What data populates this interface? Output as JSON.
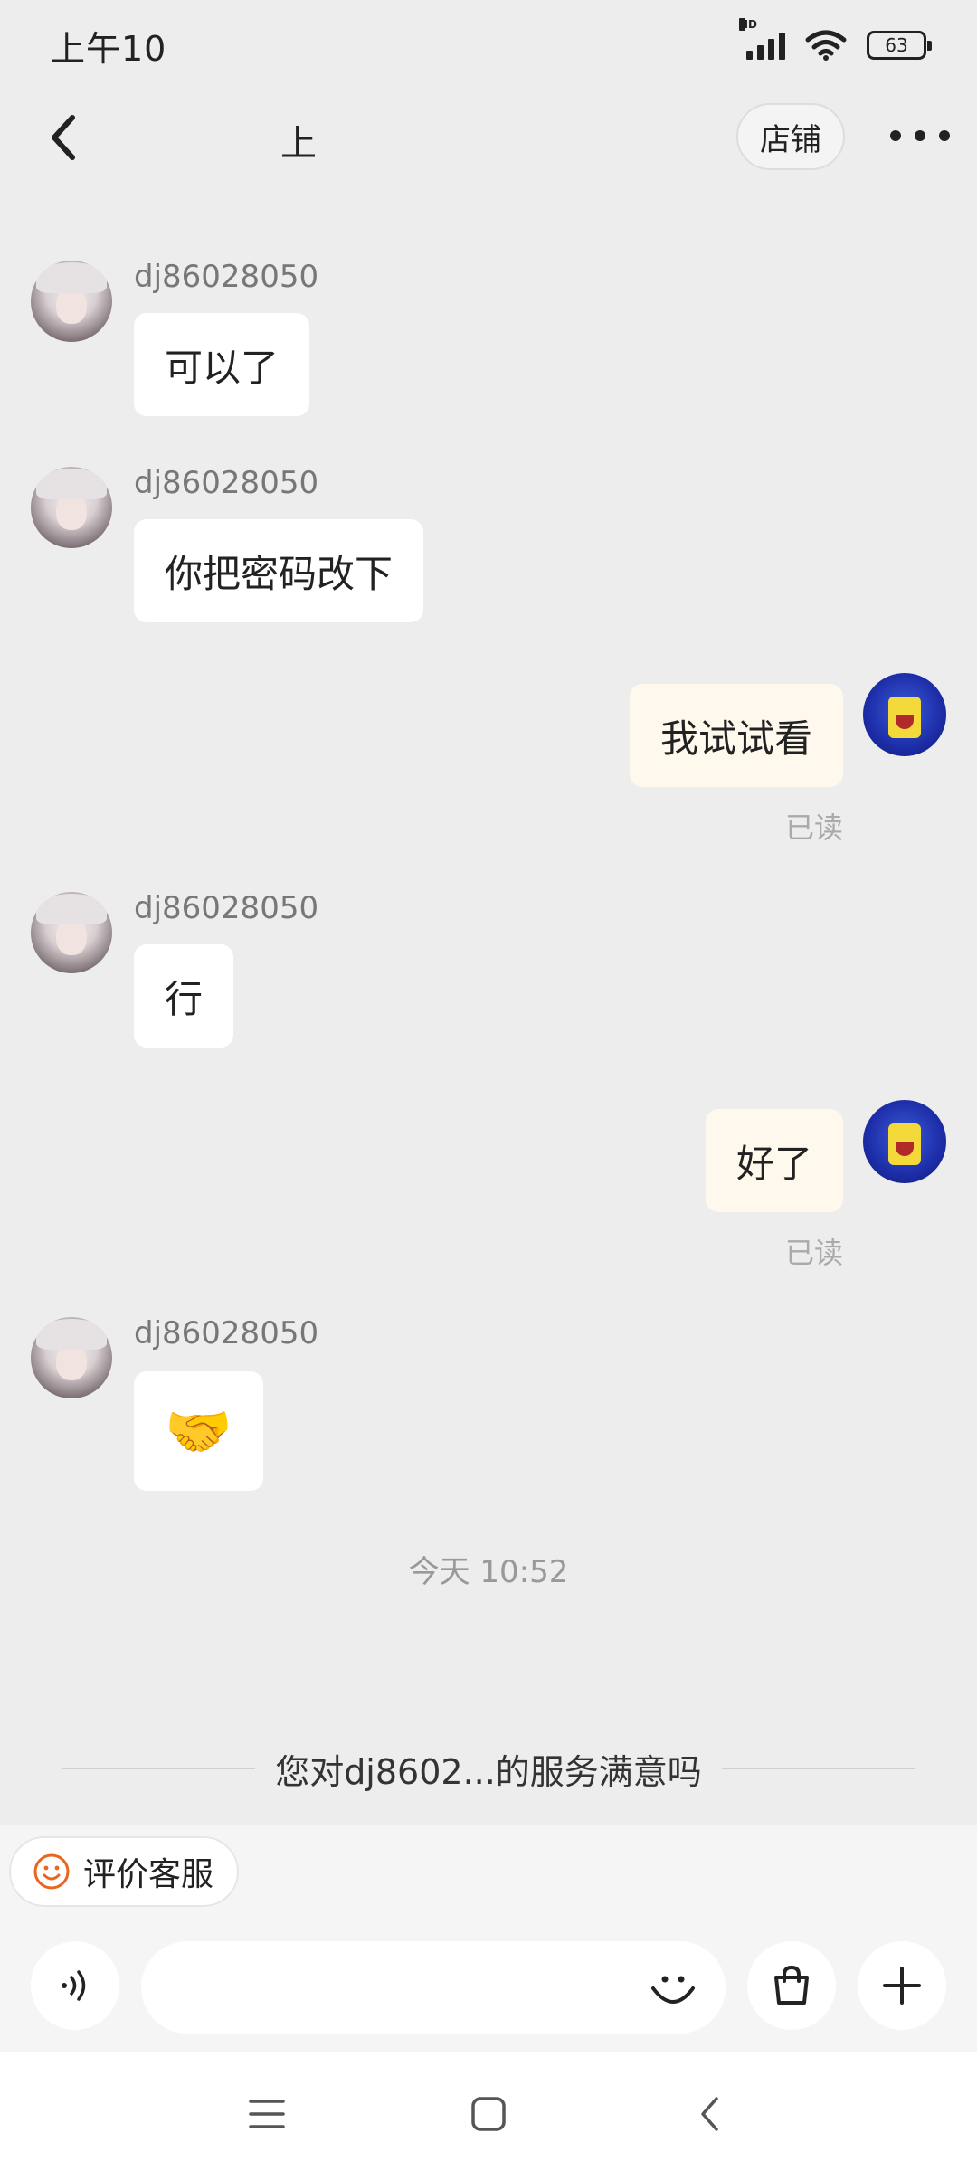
{
  "status_bar": {
    "time": "上午10",
    "battery_level": "63",
    "network_badge": "HD"
  },
  "nav": {
    "title": "上",
    "shop_label": "店铺"
  },
  "messages": [
    {
      "direction": "in",
      "sender": "dj86028050",
      "text": "可以了"
    },
    {
      "direction": "in",
      "sender": "dj86028050",
      "text": "你把密码改下"
    },
    {
      "direction": "out",
      "text": "我试试看",
      "status": "已读"
    },
    {
      "direction": "in",
      "sender": "dj86028050",
      "text": "行"
    },
    {
      "direction": "out",
      "text": "好了",
      "status": "已读"
    },
    {
      "direction": "in",
      "sender": "dj86028050",
      "text": "🤝"
    }
  ],
  "time_divider": "今天  10:52",
  "rating_prompt": "您对dj8602...的服务满意吗",
  "rate_button_label": "评价客服",
  "input": {
    "placeholder": ""
  }
}
